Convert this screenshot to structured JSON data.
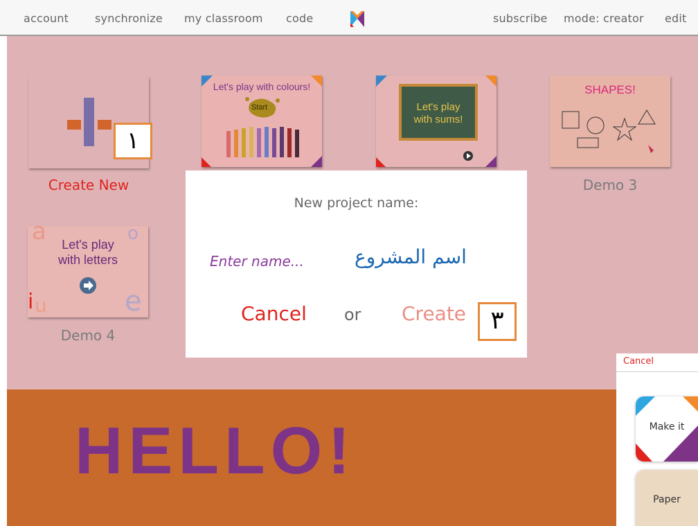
{
  "nav": {
    "left": [
      "account",
      "synchronize",
      "my classroom",
      "code"
    ],
    "right": [
      "subscribe",
      "mode: creator",
      "edit"
    ]
  },
  "tiles": {
    "create_new_label": "Create New",
    "demo1_title": "Let's play with colours!",
    "demo1_start": "Start",
    "demo2_title_line1": "Let's play",
    "demo2_title_line2": "with sums!",
    "demo3_title": "SHAPES!",
    "demo3_label": "Demo 3",
    "demo4_title_line1": "Let's play",
    "demo4_title_line2": "with letters",
    "demo4_label": "Demo 4",
    "demo4_letters": [
      "a",
      "o",
      "i",
      "u",
      "e"
    ]
  },
  "banner": {
    "text": "HELLO!"
  },
  "dialog": {
    "title": "New project name:",
    "placeholder": "Enter name...",
    "arabic_label": "اسم المشروع",
    "cancel": "Cancel",
    "or": "or",
    "create": "Create"
  },
  "annotations": {
    "badge1": "١",
    "badge3": "٣"
  },
  "side_panel": {
    "cancel": "Cancel",
    "option1": "Make it",
    "option2": "Paper"
  },
  "colors": {
    "gallery_bg": "#dfb3b6",
    "banner_bg": "#c96a2d",
    "banner_text": "#7d3486",
    "cancel_red": "#e0231e",
    "create_salmon": "#e98f86",
    "arabic_blue": "#1a67b0",
    "placeholder_purple": "#8a3a9c",
    "badge_border": "#e48a3a"
  }
}
